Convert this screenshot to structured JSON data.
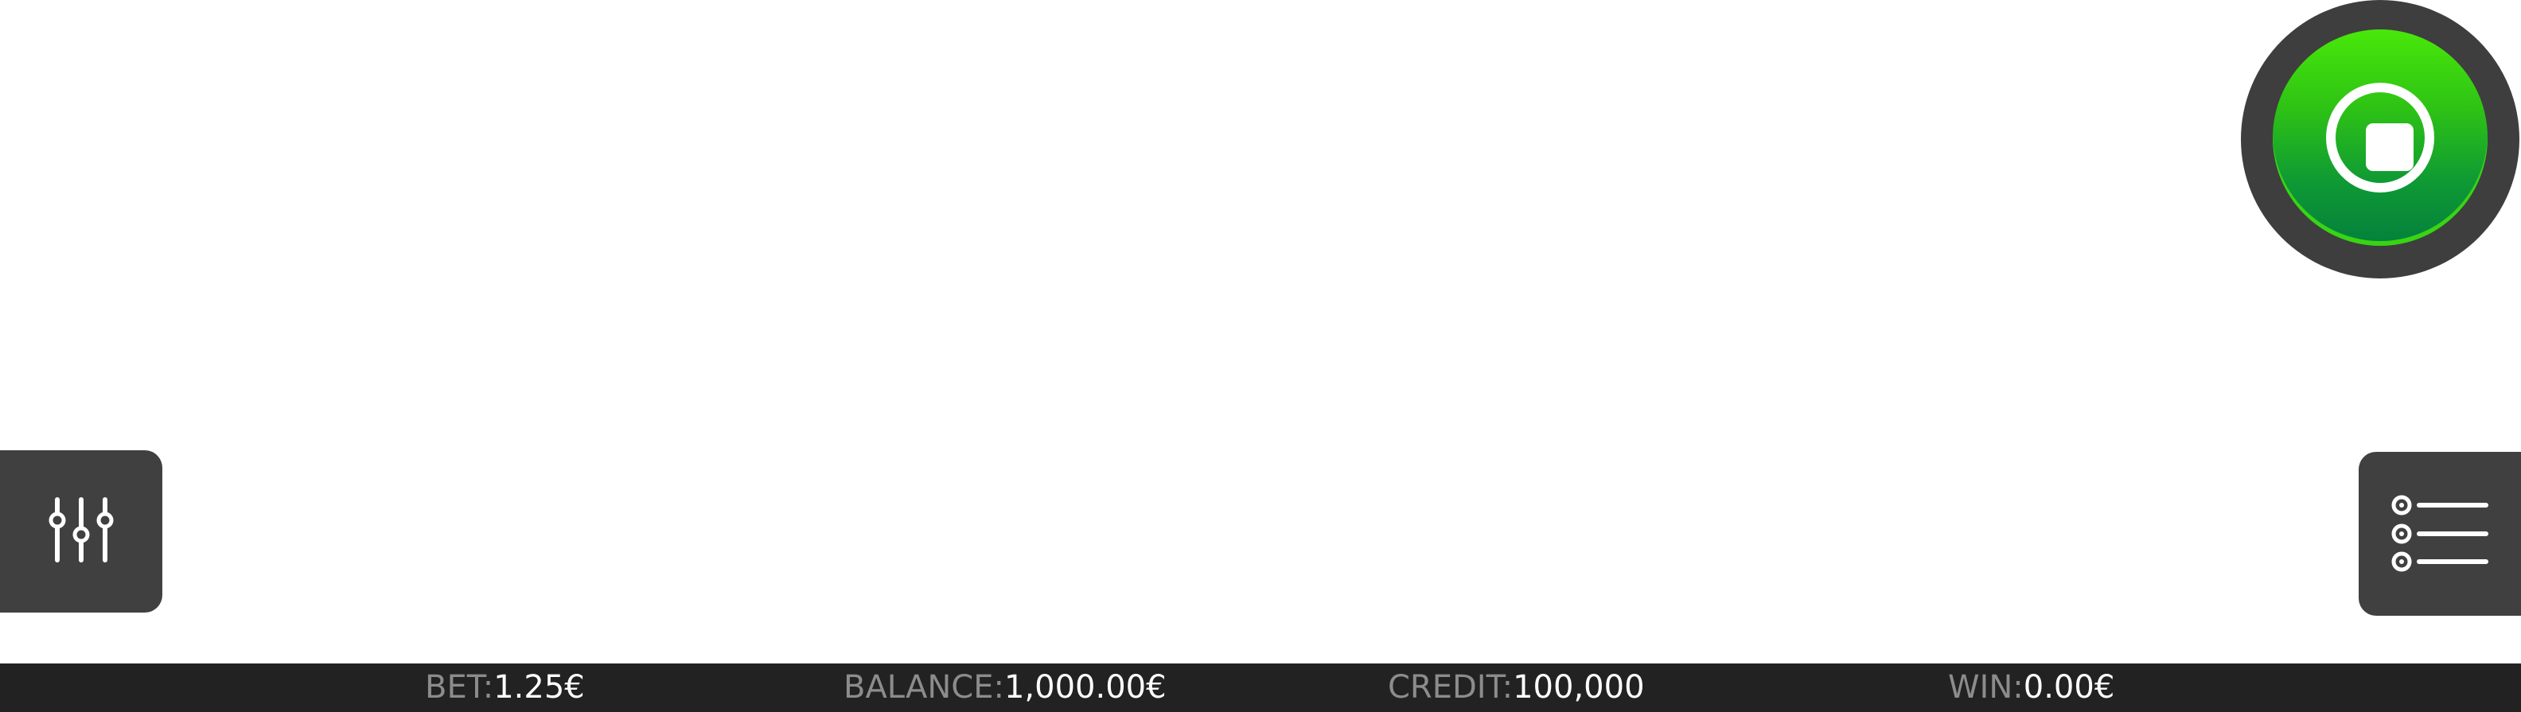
{
  "controls": {
    "spin_button": {
      "state": "stop",
      "icon": "stop-icon"
    },
    "settings_button": {
      "icon": "sliders-icon"
    },
    "menu_button": {
      "icon": "list-icon"
    }
  },
  "status_bar": {
    "bet": {
      "label": "BET:",
      "value": "1.25€"
    },
    "balance": {
      "label": "BALANCE:",
      "value": "1,000.00€"
    },
    "credit": {
      "label": "CREDIT:",
      "value": "100,000"
    },
    "win": {
      "label": "WIN:",
      "value": "0.00€"
    }
  },
  "colors": {
    "button_bg": "#404040",
    "spin_green_top": "#49e80a",
    "spin_green_bottom": "#04803c",
    "status_bar_bg": "#222222",
    "label_gray": "#8c8c8c",
    "value_white": "#ffffff"
  }
}
